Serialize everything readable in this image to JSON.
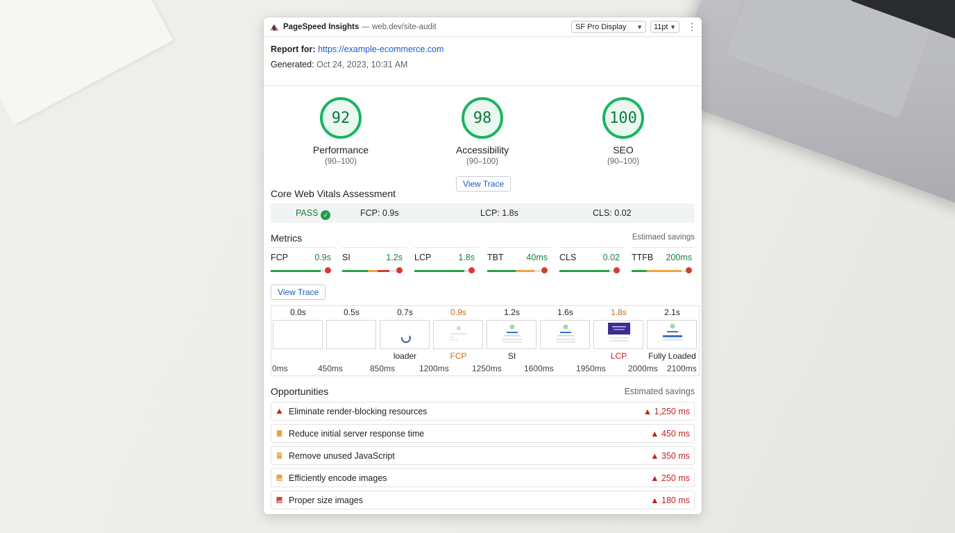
{
  "header": {
    "app_name": "PageSpeed Insights",
    "app_url": "— web.dev/site-audit",
    "font_select": "SF Pro Display",
    "size_select": "11pt"
  },
  "report": {
    "report_for_label": "Report for:",
    "url": "https://example-ecommerce.com",
    "generated_label": "Generated:",
    "generated_value": "Oct 24, 2023, 10:31 AM"
  },
  "scores": [
    {
      "value": "92",
      "name": "Performance",
      "range": "(90–100)"
    },
    {
      "value": "98",
      "name": "Accessibility",
      "range": "(90–100)"
    },
    {
      "value": "100",
      "name": "SEO",
      "range": "(90–100)"
    }
  ],
  "view_trace_label": "View Trace",
  "cwv": {
    "title": "Core Web Vitals Assessment",
    "status": "PASS",
    "fcp": "FCP: 0.9s",
    "lcp": "LCP: 1.8s",
    "cls": "CLS: 0.02"
  },
  "metrics": {
    "title": "Metrics",
    "savings_label": "Estimaed savings",
    "items": [
      {
        "name": "FCP",
        "value": "0.9s",
        "fill": 0.9
      },
      {
        "name": "SI",
        "value": "1.2s",
        "fill": 0.85
      },
      {
        "name": "LCP",
        "value": "1.8s",
        "fill": 0.9
      },
      {
        "name": "TBT",
        "value": "40ms",
        "fill": 0.85
      },
      {
        "name": "CLS",
        "value": "0.02",
        "fill": 0.9
      },
      {
        "name": "TTFB",
        "value": "200ms",
        "fill": 0.9
      }
    ]
  },
  "filmstrip": {
    "times": [
      "0.0s",
      "0.5s",
      "0.7s",
      "0.9s",
      "1.2s",
      "1.6s",
      "1.8s",
      "2.1s"
    ],
    "labels": [
      "",
      "",
      "loader",
      "FCP",
      "SI",
      "",
      "LCP",
      "Fully Loaded"
    ],
    "ms_labels": [
      "0ms",
      "450ms",
      "850ms",
      "1200ms",
      "1250ms",
      "1600ms",
      "1950ms",
      "2000ms",
      "2100ms"
    ]
  },
  "opportunities": {
    "title": "Opportunities",
    "savings_label": "Estimated savings",
    "items": [
      {
        "text": "Eliminate render-blocking resources",
        "savings": "▲ 1,250 ms",
        "icon": "warning-triangle-icon",
        "color": "#c5221f"
      },
      {
        "text": "Reduce initial server response time",
        "savings": "▲ 450 ms",
        "icon": "server-icon",
        "color": "#e8a33b"
      },
      {
        "text": "Remove unused JavaScript",
        "savings": "▲ 350 ms",
        "icon": "script-icon",
        "color": "#e8b23b"
      },
      {
        "text": "Efficiently encode images",
        "savings": "▲ 250 ms",
        "icon": "image-icon",
        "color": "#e8a33b"
      },
      {
        "text": "Proper size images",
        "savings": "▲ 180 ms",
        "icon": "resize-image-icon",
        "color": "#c9473b"
      }
    ]
  },
  "colors": {
    "good": "#18b463",
    "accent": "#1a5bbf",
    "bad": "#c5221f",
    "average": "#c26a13"
  }
}
